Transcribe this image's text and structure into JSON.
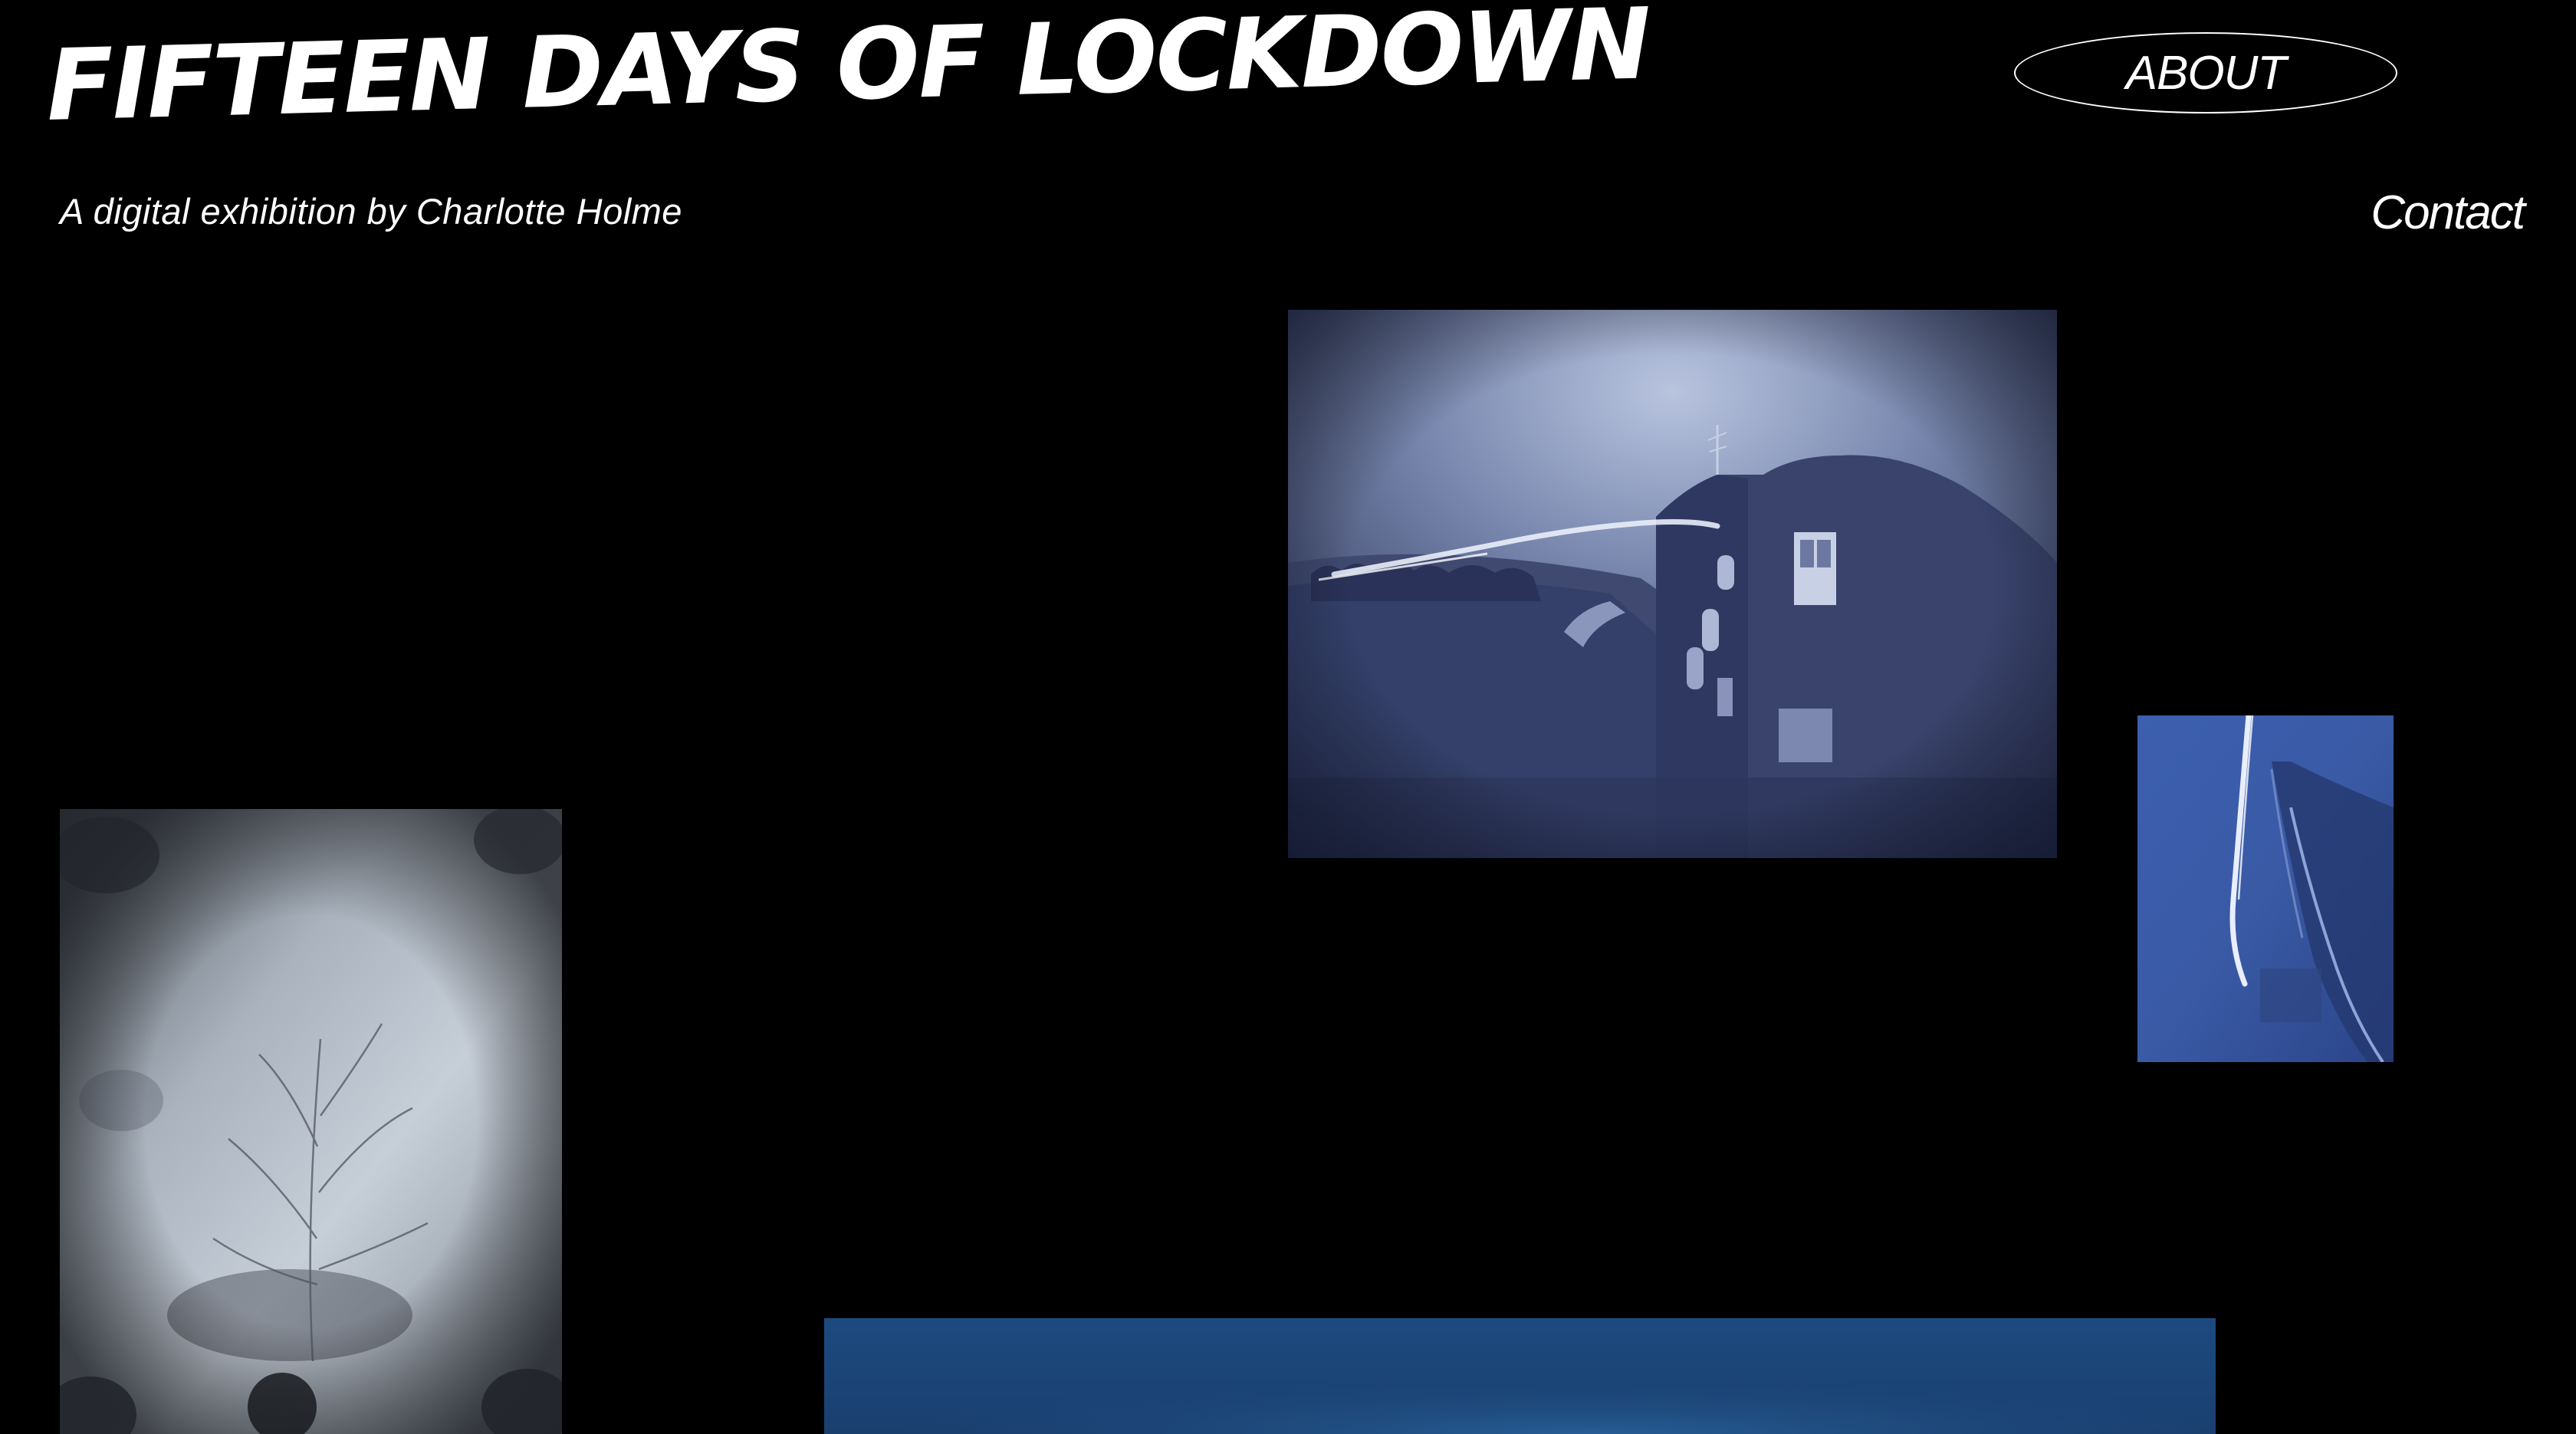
{
  "header": {
    "title": "FIFTEEN DAYS OF LOCKDOWN",
    "subtitle": "A digital exhibition by Charlotte Holme",
    "about_label": "ABOUT",
    "contact_label": "Contact"
  },
  "colors": {
    "background": "#000000",
    "text": "#ffffff"
  },
  "gallery": {
    "photos": [
      {
        "name": "rooftop-street-solargraph"
      },
      {
        "name": "cliff-coast-solargraph"
      },
      {
        "name": "plant-shadow-print"
      },
      {
        "name": "sea-horizon-solargraph"
      }
    ]
  }
}
